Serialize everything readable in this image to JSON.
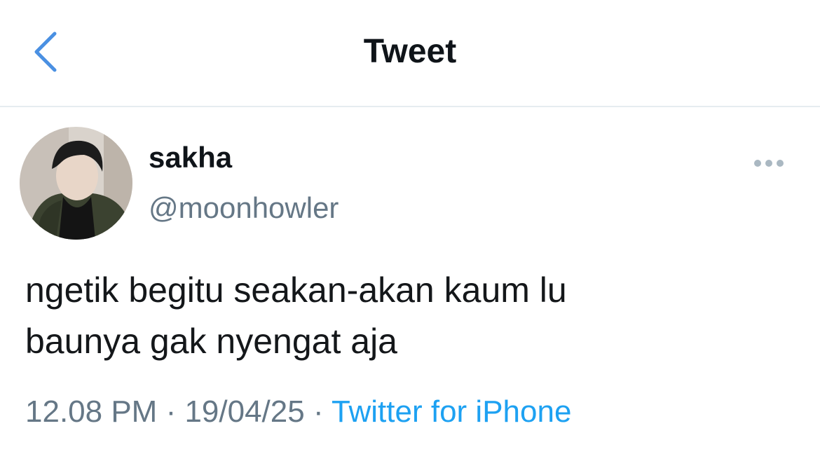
{
  "header": {
    "title": "Tweet",
    "back_icon": "chevron-left-icon"
  },
  "tweet": {
    "display_name": "sakha",
    "handle": "@moonhowler",
    "text": "ngetik begitu seakan-akan kaum lu\nbaunya gak nyengat aja",
    "time": "12.08 PM",
    "date": "19/04/25",
    "separator": " · ",
    "source": "Twitter for iPhone",
    "more_icon": "more-horizontal-icon"
  },
  "colors": {
    "accent": "#1da1f2",
    "secondary_text": "#657786",
    "primary_text": "#14171a",
    "divider": "#e6ecf0"
  }
}
